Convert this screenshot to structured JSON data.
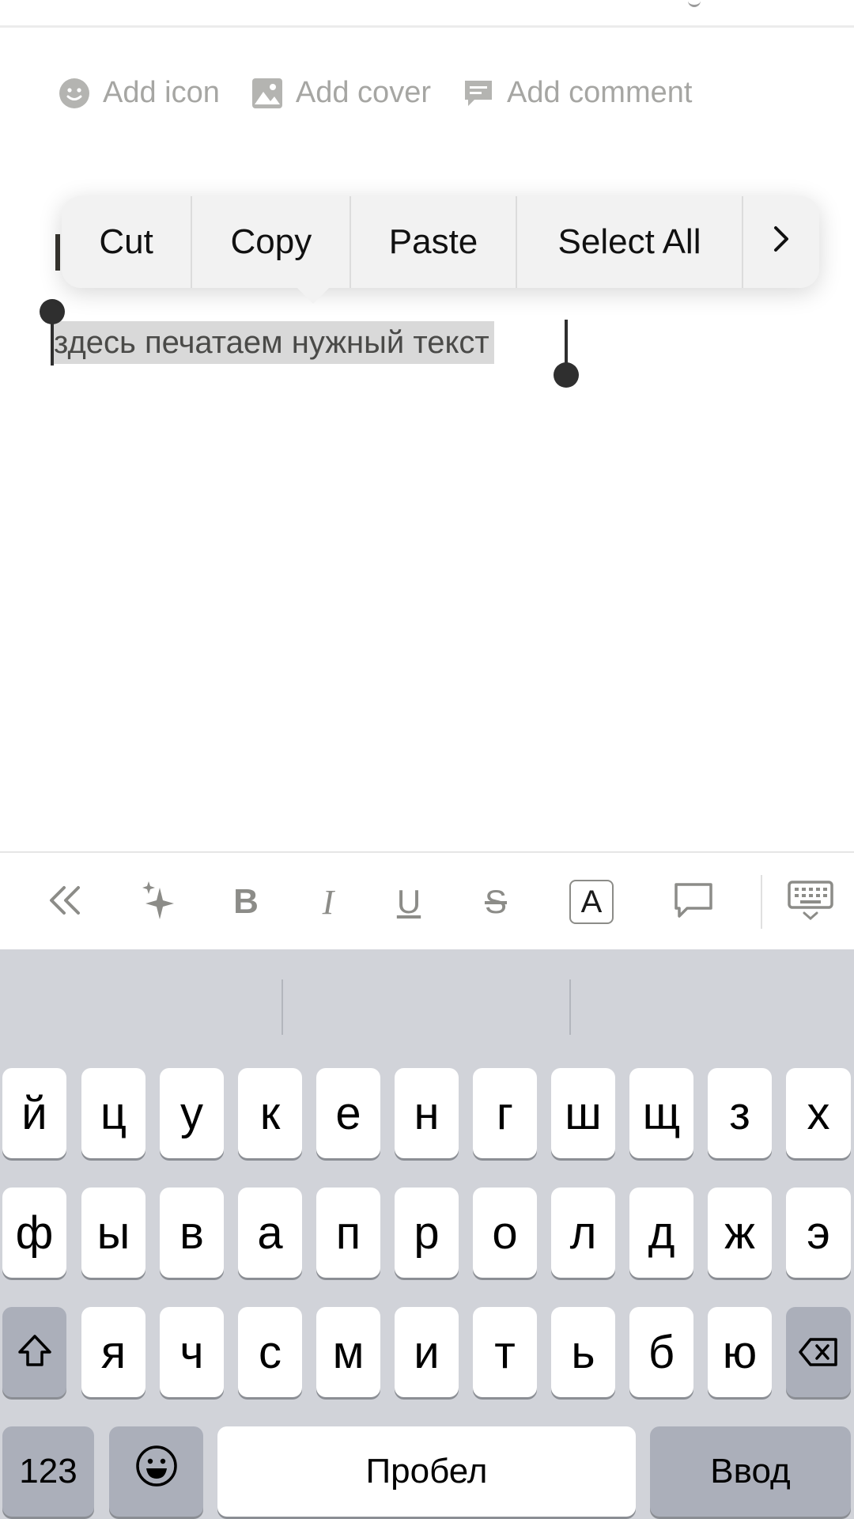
{
  "page_actions": [
    {
      "label": "Add icon",
      "icon": "smiley-icon"
    },
    {
      "label": "Add cover",
      "icon": "image-icon"
    },
    {
      "label": "Add comment",
      "icon": "comment-icon"
    }
  ],
  "editor": {
    "selected_text": "здесь печатаем нужный текст"
  },
  "context_menu": {
    "items": [
      "Cut",
      "Copy",
      "Paste",
      "Select All"
    ],
    "more_icon": "chevron-right-icon"
  },
  "toolbar": {
    "icons": [
      "collapse-double-chevron-icon",
      "ai-sparkle-icon",
      "bold-icon",
      "italic-icon",
      "underline-icon",
      "strikethrough-icon",
      "text-color-icon",
      "comment-bubble-icon",
      "hide-keyboard-icon"
    ],
    "bold_glyph": "B",
    "italic_glyph": "I",
    "underline_glyph": "U",
    "strike_glyph": "S",
    "color_glyph": "A"
  },
  "keyboard": {
    "row1": [
      "й",
      "ц",
      "у",
      "к",
      "е",
      "н",
      "г",
      "ш",
      "щ",
      "з",
      "х"
    ],
    "row2": [
      "ф",
      "ы",
      "в",
      "а",
      "п",
      "р",
      "о",
      "л",
      "д",
      "ж",
      "э"
    ],
    "row3": [
      "я",
      "ч",
      "с",
      "м",
      "и",
      "т",
      "ь",
      "б",
      "ю"
    ],
    "numbers_key": "123",
    "space_key": "Пробел",
    "return_key": "Ввод"
  }
}
